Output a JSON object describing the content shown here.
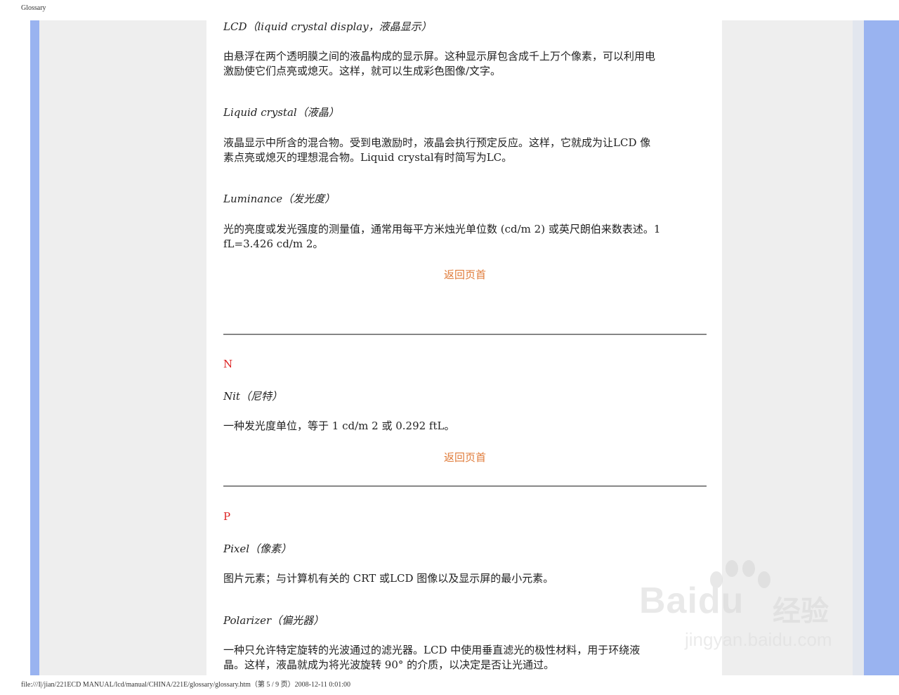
{
  "header": {
    "title": "Glossary"
  },
  "footer": {
    "text": "file:///I|/jian/221ECD MANUAL/lcd/manual/CHINA/221E/glossary/glossary.htm（第 5 / 9 页）2008-12-11 0:01:00"
  },
  "entries_top": [
    {
      "term": "LCD（liquid crystal display，液晶显示）",
      "desc": [
        "由悬浮在两个透明膜之间的液晶构成的显示屏。这种显示屏包含成千上万个像素，可以利用电",
        "激励使它们点亮或熄灭。这样，就可以生成彩色图像/文字。"
      ]
    },
    {
      "term": "Liquid crystal（液晶）",
      "desc": [
        "液晶显示中所含的混合物。受到电激励时，液晶会执行预定反应。这样，它就成为让LCD 像",
        "素点亮或熄灭的理想混合物。Liquid crystal有时简写为LC。"
      ]
    },
    {
      "term": "Luminance（发光度）",
      "desc": [
        "光的亮度或发光强度的测量值，通常用每平方米烛光单位数 (cd/m 2) 或英尺朗伯来数表述。1",
        "fL=3.426 cd/m 2。"
      ]
    }
  ],
  "back_to_top": "返回页首",
  "section_n": {
    "letter": "N",
    "entries": [
      {
        "term": "Nit（尼特）",
        "desc": [
          "一种发光度单位，等于 1 cd/m 2 或 0.292 ftL。"
        ]
      }
    ]
  },
  "section_p": {
    "letter": "P",
    "entries": [
      {
        "term": "Pixel（像素）",
        "desc": [
          "图片元素；与计算机有关的 CRT 或LCD 图像以及显示屏的最小元素。"
        ]
      },
      {
        "term": "Polarizer（偏光器）",
        "desc": [
          "一种只允许特定旋转的光波通过的滤光器。LCD 中使用垂直滤光的极性材料，用于环绕液",
          "晶。这样，液晶就成为将光波旋转 90° 的介质，以决定是否让光通过。"
        ]
      }
    ]
  },
  "watermark": {
    "logo": "Baidu",
    "product": "经验",
    "url": "jingyan.baidu.com"
  }
}
